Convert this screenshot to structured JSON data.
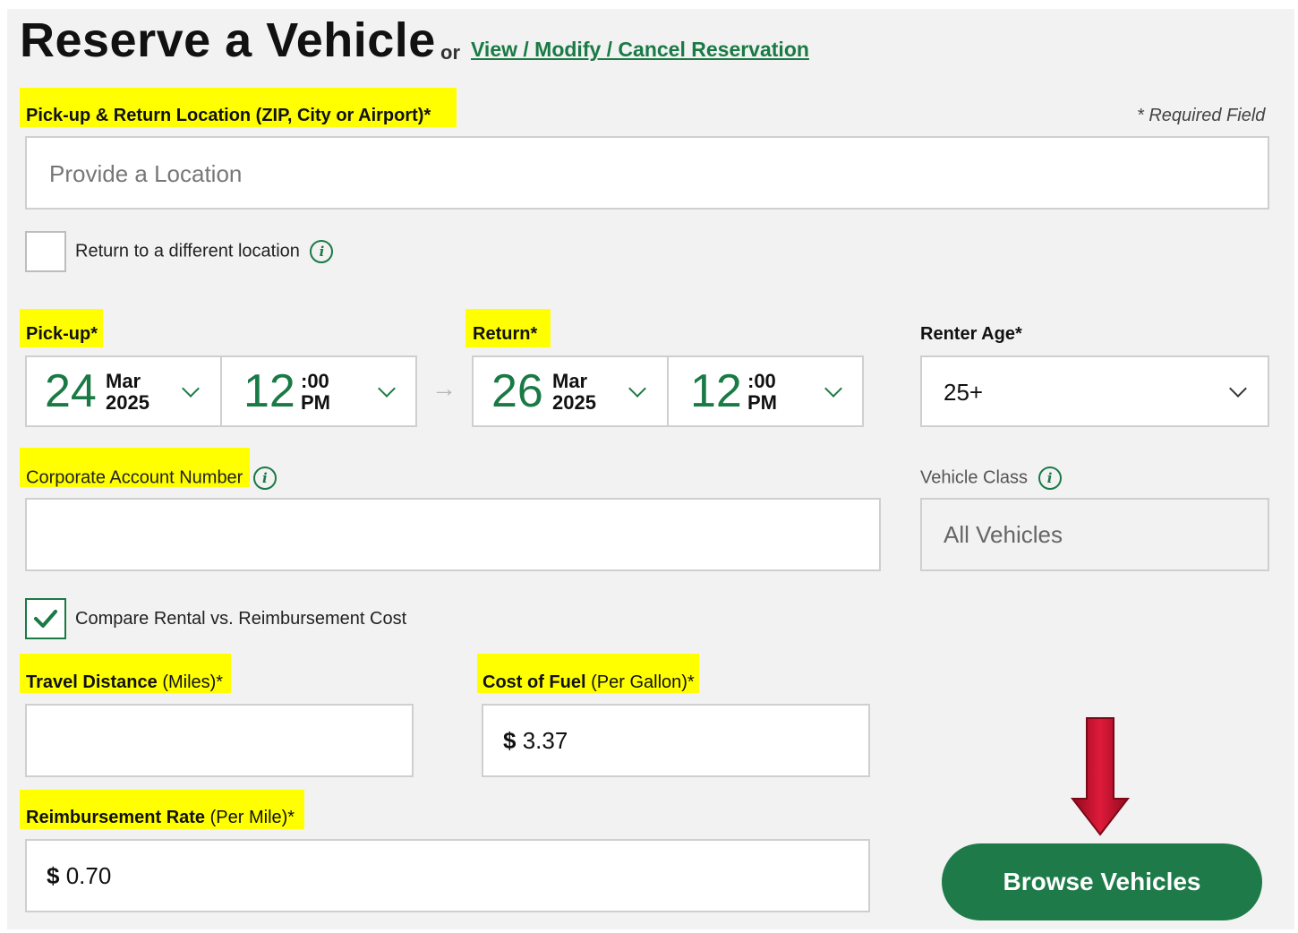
{
  "header": {
    "title": "Reserve a Vehicle",
    "or": "or",
    "manage_link": "View / Modify / Cancel Reservation"
  },
  "location": {
    "label": "Pick-up & Return Location (ZIP, City or Airport)*",
    "required_note": "* Required Field",
    "placeholder": "Provide a Location"
  },
  "return_different": {
    "label": "Return to a different location",
    "checked": false
  },
  "pickup": {
    "label": "Pick-up*",
    "day": "24",
    "month": "Mar",
    "year": "2025",
    "hour": "12",
    "minute": ":00",
    "ampm": "PM"
  },
  "return": {
    "label": "Return*",
    "day": "26",
    "month": "Mar",
    "year": "2025",
    "hour": "12",
    "minute": ":00",
    "ampm": "PM"
  },
  "renter_age": {
    "label": "Renter Age*",
    "value": "25+"
  },
  "corporate": {
    "label": "Corporate Account Number",
    "value": ""
  },
  "vehicle_class": {
    "label": "Vehicle Class",
    "value": "All Vehicles"
  },
  "compare": {
    "label": "Compare Rental vs. Reimbursement Cost",
    "checked": true
  },
  "travel_distance": {
    "label": "Travel Distance",
    "unit": "(Miles)*",
    "value": ""
  },
  "fuel_cost": {
    "label": "Cost of Fuel",
    "unit": "(Per Gallon)*",
    "currency": "$",
    "value": "3.37"
  },
  "reimbursement": {
    "label": "Reimbursement Rate",
    "unit": "(Per Mile)*",
    "currency": "$",
    "value": "0.70"
  },
  "browse_button": "Browse Vehicles",
  "colors": {
    "accent": "#1e7b49",
    "highlight": "#ffff00",
    "arrow": "#c8102e"
  }
}
